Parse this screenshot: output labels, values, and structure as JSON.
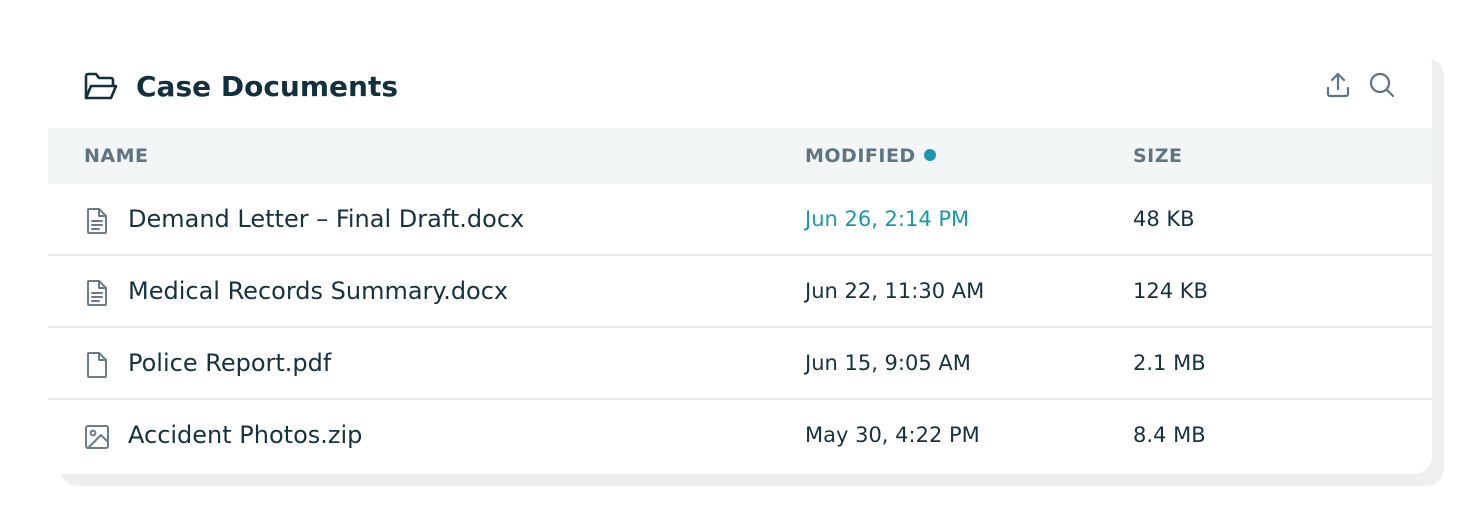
{
  "panel": {
    "title": "Case Documents",
    "folder_icon": "folder-open-icon",
    "actions": [
      {
        "name": "upload",
        "icon": "upload-icon"
      },
      {
        "name": "search",
        "icon": "search-icon"
      }
    ]
  },
  "table": {
    "headers": {
      "name": "NAME",
      "modified": "MODIFIED",
      "size": "SIZE"
    },
    "sort_indicator_color": "#1a97ad",
    "rows": [
      {
        "icon": "document-icon",
        "name": "Demand Letter – Final Draft.docx",
        "modified": "Jun 26, 2:14 PM",
        "size": "48 KB",
        "recent": true
      },
      {
        "icon": "document-icon",
        "name": "Medical Records Summary.docx",
        "modified": "Jun 22, 11:30 AM",
        "size": "124 KB",
        "recent": false
      },
      {
        "icon": "file-icon",
        "name": "Police Report.pdf",
        "modified": "Jun 15, 9:05 AM",
        "size": "2.1 MB",
        "recent": false
      },
      {
        "icon": "image-icon",
        "name": "Accident Photos.zip",
        "modified": "May 30, 4:22 PM",
        "size": "8.4 MB",
        "recent": false
      }
    ]
  },
  "colors": {
    "accent": "#1a97ad",
    "text_primary": "#12303d",
    "text_muted": "#5f7480",
    "header_bg": "#f3f6f7"
  }
}
